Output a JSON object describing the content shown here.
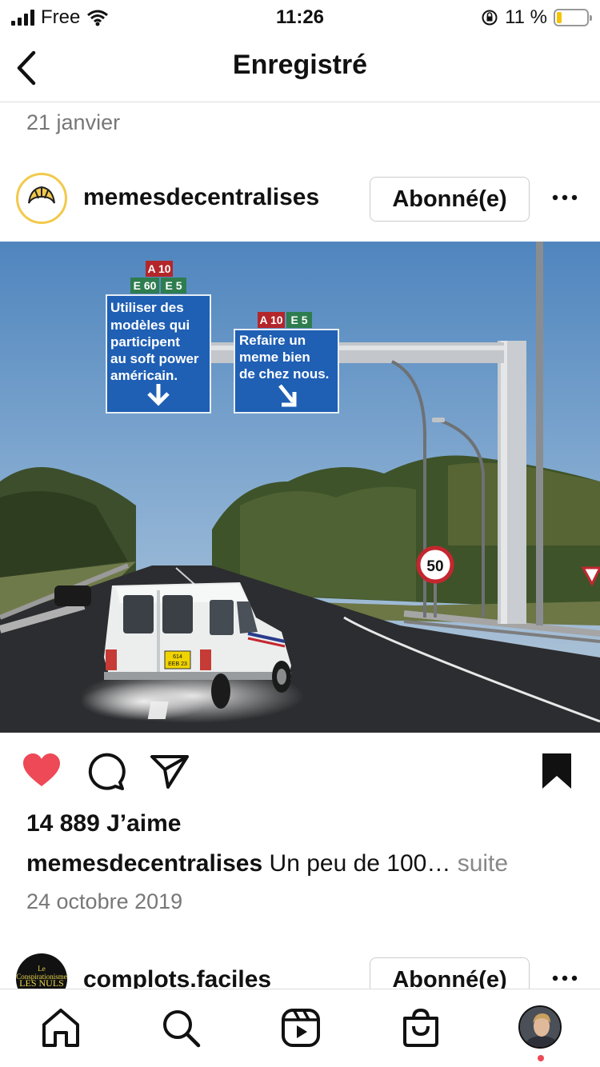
{
  "status_bar": {
    "carrier": "Free",
    "time": "11:26",
    "battery": "11 %",
    "battery_level": 0.11
  },
  "header": {
    "title": "Enregistré"
  },
  "top_date": "21 janvier",
  "post": {
    "username": "memesdecentralises",
    "follow_label": "Abonné(e)",
    "image": {
      "sign_left": {
        "route_top": "A 10",
        "route_codes": [
          "E 60",
          "E 5"
        ],
        "lines": [
          "Utiliser des",
          "modèles qui",
          "participent",
          "au soft power",
          "américain."
        ]
      },
      "sign_right": {
        "route_codes": [
          "A 10",
          "E 5"
        ],
        "lines": [
          "Refaire un",
          "meme bien",
          "de chez nous."
        ]
      },
      "speed_limit": "50",
      "plate": [
        "614",
        "EEB 23"
      ]
    },
    "likes": "14 889 J’aime",
    "caption_user": "memesdecentralises",
    "caption_text": " Un peu de 100…",
    "caption_more": " suite",
    "date": "24 octobre 2019",
    "liked": true,
    "saved": true
  },
  "next_post": {
    "username": "complots.faciles",
    "follow_label": "Abonné(e)",
    "avatar_text": [
      "Le Conspirationisme",
      "LES NULS"
    ]
  },
  "colors": {
    "like": "#ed4956",
    "sign_blue": "#1f5fb4",
    "route_red": "#b3262a",
    "route_green": "#2e7d4f"
  },
  "tabs": [
    "home-icon",
    "search-icon",
    "reels-icon",
    "shop-icon",
    "profile-avatar"
  ]
}
